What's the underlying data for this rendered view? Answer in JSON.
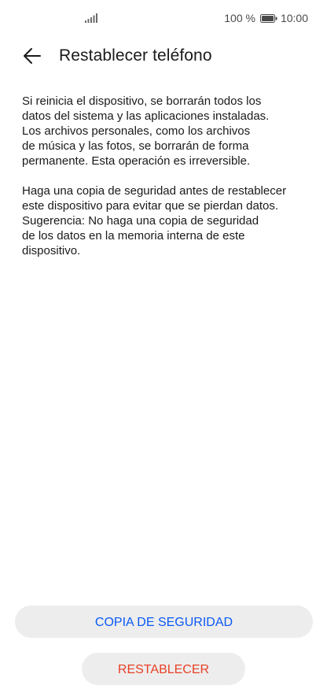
{
  "status_bar": {
    "battery_percent": "100 %",
    "time": "10:00",
    "signal_icon": "signal-icon",
    "battery_icon": "battery-icon"
  },
  "header": {
    "back_icon": "arrow-left-icon",
    "title": "Restablecer teléfono"
  },
  "body": {
    "paragraph_1": "Si reinicia el dispositivo, se borrarán todos los\ndatos del sistema y las aplicaciones instaladas.\nLos archivos personales, como los archivos\nde música y las fotos, se borrarán de forma\npermanente. Esta operación es irreversible.",
    "paragraph_2": "Haga una copia de seguridad antes de restablecer\neste dispositivo para evitar que se pierdan datos.\nSugerencia: No haga una copia de seguridad\nde los datos en la memoria interna de este\ndispositivo."
  },
  "actions": {
    "backup_label": "COPIA DE SEGURIDAD",
    "reset_label": "RESTABLECER"
  },
  "colors": {
    "accent": "#0a59f7",
    "danger": "#e84026",
    "button_bg": "#ededed"
  }
}
